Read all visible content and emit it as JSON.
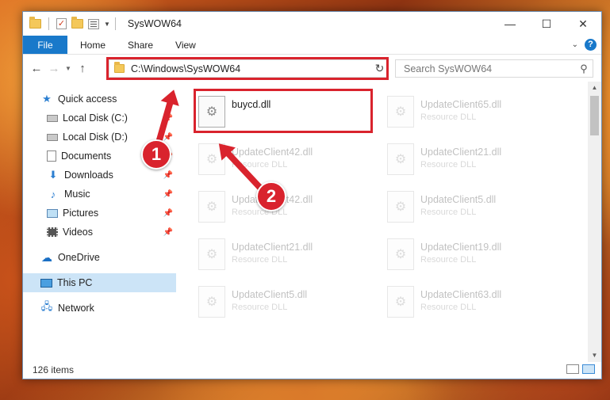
{
  "window": {
    "title": "SysWOW64",
    "controls": {
      "minimize": "—",
      "maximize": "☐",
      "close": "✕"
    }
  },
  "ribbon": {
    "tabs": [
      "File",
      "Home",
      "Share",
      "View"
    ],
    "help": "?"
  },
  "navbar": {
    "back": "←",
    "forward": "→",
    "up": "↑",
    "address": "C:\\Windows\\SysWOW64",
    "search_placeholder": "Search SysWOW64"
  },
  "sidebar": {
    "quick_access": "Quick access",
    "items": [
      {
        "label": "Local Disk (C:)",
        "pinned": true
      },
      {
        "label": "Local Disk (D:)",
        "pinned": true
      },
      {
        "label": "Documents",
        "pinned": true
      },
      {
        "label": "Downloads",
        "pinned": true
      },
      {
        "label": "Music",
        "pinned": true
      },
      {
        "label": "Pictures",
        "pinned": true
      },
      {
        "label": "Videos",
        "pinned": true
      }
    ],
    "onedrive": "OneDrive",
    "this_pc": "This PC",
    "network": "Network"
  },
  "files": [
    {
      "name": "buycd.dll",
      "type": ""
    },
    {
      "name": "UpdateClient65.dll",
      "type": "Resource DLL"
    },
    {
      "name": "UpdateClient42.dll",
      "type": "Resource DLL"
    },
    {
      "name": "UpdateClient21.dll",
      "type": "Resource DLL"
    },
    {
      "name": "UpdateClient42.dll",
      "type": "Resource DLL"
    },
    {
      "name": "UpdateClient5.dll",
      "type": "Resource DLL"
    },
    {
      "name": "UpdateClient21.dll",
      "type": "Resource DLL"
    },
    {
      "name": "UpdateClient19.dll",
      "type": "Resource DLL"
    },
    {
      "name": "UpdateClient5.dll",
      "type": "Resource DLL"
    },
    {
      "name": "UpdateClient63.dll",
      "type": "Resource DLL"
    }
  ],
  "status": {
    "item_count": "126 items"
  },
  "annotations": {
    "step1": "1",
    "step2": "2",
    "color": "#d9232d"
  }
}
